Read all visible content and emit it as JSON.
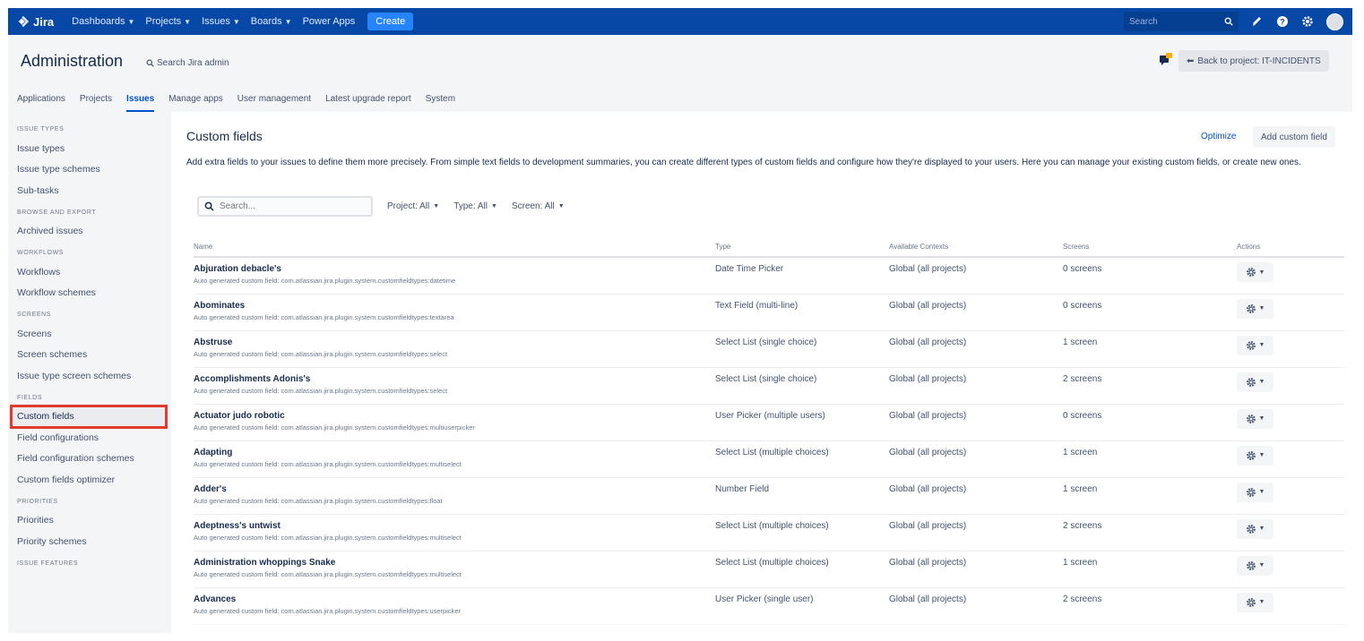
{
  "topnav": {
    "logo": "Jira",
    "items": [
      {
        "label": "Dashboards",
        "has_caret": true
      },
      {
        "label": "Projects",
        "has_caret": true
      },
      {
        "label": "Issues",
        "has_caret": true
      },
      {
        "label": "Boards",
        "has_caret": true
      },
      {
        "label": "Power Apps",
        "has_caret": false
      }
    ],
    "create_label": "Create",
    "search_placeholder": "Search"
  },
  "admin": {
    "title": "Administration",
    "search_label": "Search Jira admin",
    "back_label": "Back to project: IT-INCIDENTS",
    "tabs": [
      "Applications",
      "Projects",
      "Issues",
      "Manage apps",
      "User management",
      "Latest upgrade report",
      "System"
    ],
    "active_tab": "Issues"
  },
  "sidebar": {
    "groups": [
      {
        "heading": "ISSUE TYPES",
        "items": [
          "Issue types",
          "Issue type schemes",
          "Sub-tasks"
        ]
      },
      {
        "heading": "BROWSE AND EXPORT",
        "items": [
          "Archived issues"
        ]
      },
      {
        "heading": "WORKFLOWS",
        "items": [
          "Workflows",
          "Workflow schemes"
        ]
      },
      {
        "heading": "SCREENS",
        "items": [
          "Screens",
          "Screen schemes",
          "Issue type screen schemes"
        ]
      },
      {
        "heading": "FIELDS",
        "items": [
          "Custom fields",
          "Field configurations",
          "Field configuration schemes",
          "Custom fields optimizer"
        ]
      },
      {
        "heading": "PRIORITIES",
        "items": [
          "Priorities",
          "Priority schemes"
        ]
      },
      {
        "heading": "ISSUE FEATURES",
        "items": []
      }
    ],
    "selected_item": "Custom fields"
  },
  "main": {
    "title": "Custom fields",
    "optimize_label": "Optimize",
    "add_label": "Add custom field",
    "description": "Add extra fields to your issues to define them more precisely. From simple text fields to development summaries, you can create different types of custom fields and configure how they're displayed to your users. Here you can manage your existing custom fields, or create new ones.",
    "search_placeholder": "Search...",
    "filters": [
      "Project: All",
      "Type: All",
      "Screen: All"
    ],
    "columns": [
      "Name",
      "Type",
      "Available Contexts",
      "Screens",
      "Actions"
    ],
    "rows": [
      {
        "name": "Abjuration debacle's",
        "desc": "Auto generated custom field: com.atlassian.jira.plugin.system.customfieldtypes:datetime",
        "type": "Date Time Picker",
        "context": "Global (all projects)",
        "screens": "0 screens",
        "screens_link": false
      },
      {
        "name": "Abominates",
        "desc": "Auto generated custom field: com.atlassian.jira.plugin.system.customfieldtypes:textarea",
        "type": "Text Field (multi-line)",
        "context": "Global (all projects)",
        "screens": "0 screens",
        "screens_link": false
      },
      {
        "name": "Abstruse",
        "desc": "Auto generated custom field: com.atlassian.jira.plugin.system.customfieldtypes:select",
        "type": "Select List (single choice)",
        "context": "Global (all projects)",
        "screens": "1 screen",
        "screens_link": true
      },
      {
        "name": "Accomplishments Adonis's",
        "desc": "Auto generated custom field: com.atlassian.jira.plugin.system.customfieldtypes:select",
        "type": "Select List (single choice)",
        "context": "Global (all projects)",
        "screens": "2 screens",
        "screens_link": true
      },
      {
        "name": "Actuator judo robotic",
        "desc": "Auto generated custom field: com.atlassian.jira.plugin.system.customfieldtypes:multiuserpicker",
        "type": "User Picker (multiple users)",
        "context": "Global (all projects)",
        "screens": "0 screens",
        "screens_link": false
      },
      {
        "name": "Adapting",
        "desc": "Auto generated custom field: com.atlassian.jira.plugin.system.customfieldtypes:multiselect",
        "type": "Select List (multiple choices)",
        "context": "Global (all projects)",
        "screens": "1 screen",
        "screens_link": true
      },
      {
        "name": "Adder's",
        "desc": "Auto generated custom field: com.atlassian.jira.plugin.system.customfieldtypes:float",
        "type": "Number Field",
        "context": "Global (all projects)",
        "screens": "1 screen",
        "screens_link": true
      },
      {
        "name": "Adeptness's untwist",
        "desc": "Auto generated custom field: com.atlassian.jira.plugin.system.customfieldtypes:multiselect",
        "type": "Select List (multiple choices)",
        "context": "Global (all projects)",
        "screens": "2 screens",
        "screens_link": true
      },
      {
        "name": "Administration whoppings Snake",
        "desc": "Auto generated custom field: com.atlassian.jira.plugin.system.customfieldtypes:multiselect",
        "type": "Select List (multiple choices)",
        "context": "Global (all projects)",
        "screens": "1 screen",
        "screens_link": true
      },
      {
        "name": "Advances",
        "desc": "Auto generated custom field: com.atlassian.jira.plugin.system.customfieldtypes:userpicker",
        "type": "User Picker (single user)",
        "context": "Global (all projects)",
        "screens": "2 screens",
        "screens_link": true
      }
    ]
  },
  "colors": {
    "topnav_bg": "#0747a6",
    "create_bg": "#2684ff",
    "link": "#0052cc",
    "highlight_outline": "#e23b2e"
  },
  "icons": [
    "jira-logo-icon",
    "chevron-down-icon",
    "search-icon",
    "notifications-icon",
    "help-icon",
    "settings-icon",
    "avatar",
    "feedback-icon",
    "back-arrow-icon",
    "gear-icon"
  ]
}
